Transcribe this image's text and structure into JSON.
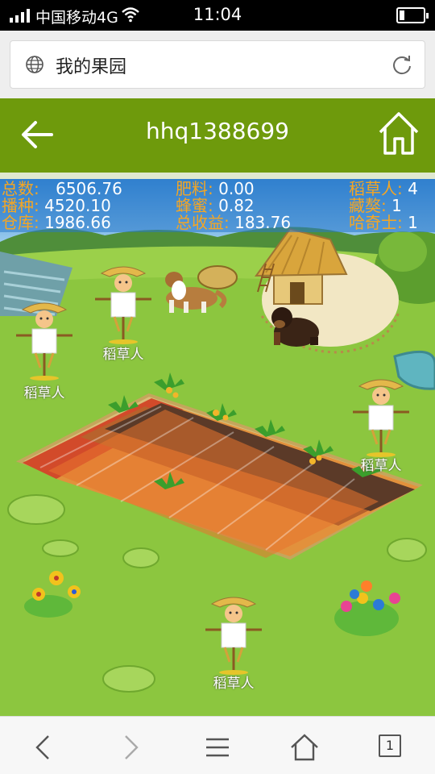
{
  "status_bar": {
    "carrier": "中国移动4G",
    "time": "11:04"
  },
  "browser": {
    "page_title": "我的果园",
    "tab_count": "1"
  },
  "header": {
    "username": "hhq1388699"
  },
  "stats": {
    "col1": [
      {
        "label": "总数:",
        "value": "6506.76"
      },
      {
        "label": "播种:",
        "value": "4520.10"
      },
      {
        "label": "仓库:",
        "value": "1986.66"
      }
    ],
    "col2": [
      {
        "label": "肥料:",
        "value": "0.00"
      },
      {
        "label": "蜂蜜:",
        "value": "0.82"
      },
      {
        "label": "总收益:",
        "value": "183.76"
      }
    ],
    "col3": [
      {
        "label": "稻草人:",
        "value": "4"
      },
      {
        "label": "藏獒:",
        "value": "1"
      },
      {
        "label": "哈奇士:",
        "value": "1"
      }
    ]
  },
  "scarecrows": [
    {
      "label": "稻草人"
    },
    {
      "label": "稻草人"
    },
    {
      "label": "稻草人"
    },
    {
      "label": "稻草人"
    }
  ],
  "colors": {
    "header_green": "#6e9a0c",
    "stat_label": "#f5a623",
    "grass": "#8cc63f"
  }
}
